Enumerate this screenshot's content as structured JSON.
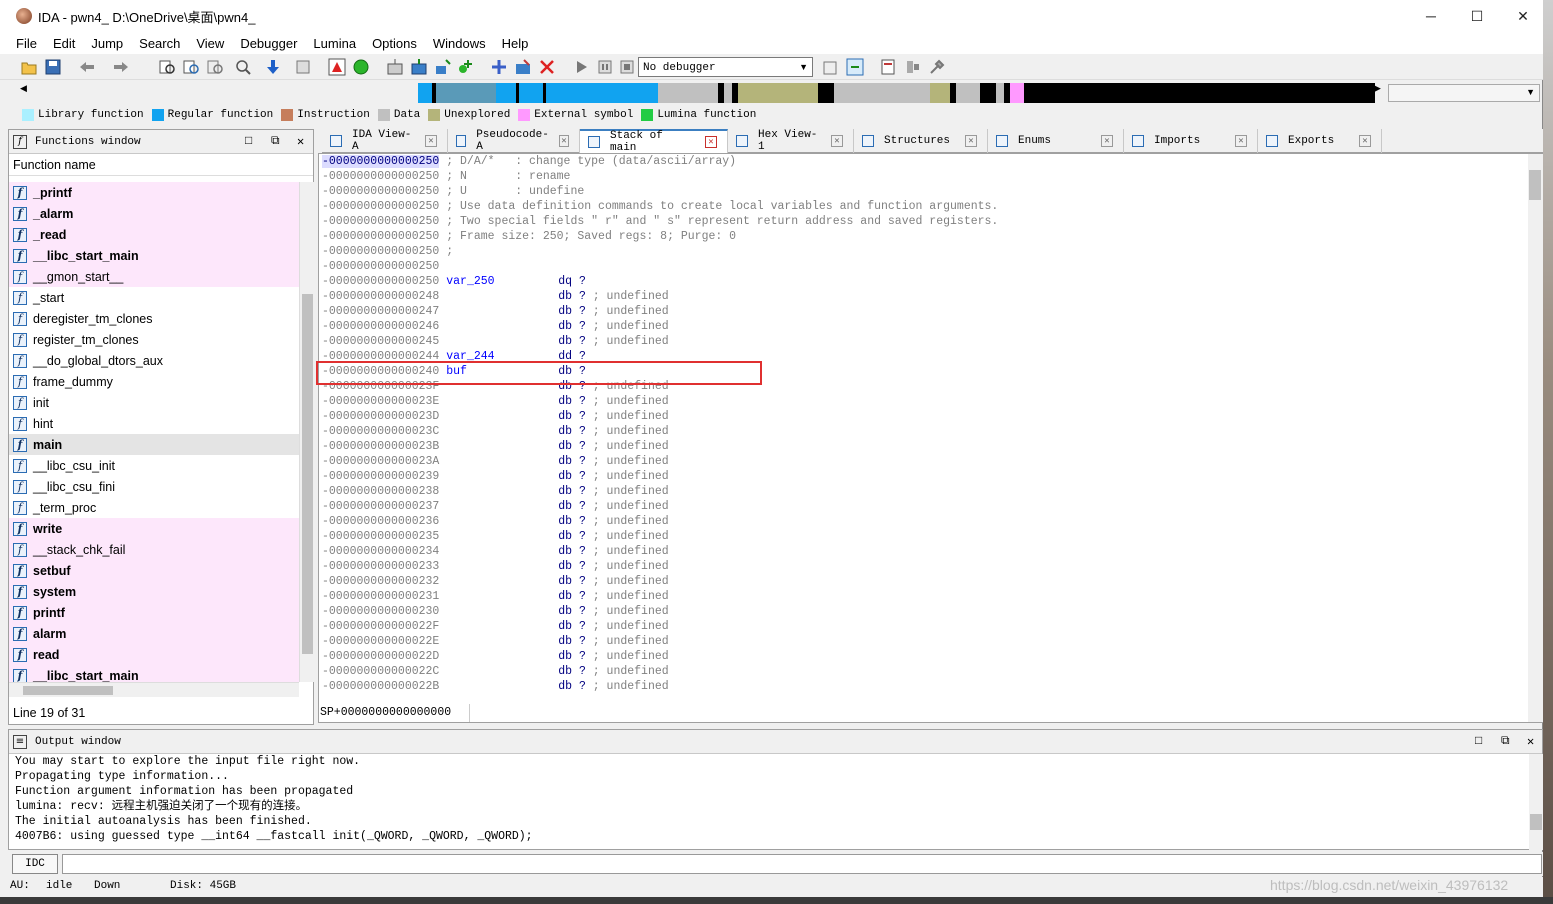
{
  "window": {
    "title": "IDA - pwn4_ D:\\OneDrive\\桌面\\pwn4_",
    "minimize": "─",
    "maximize": "☐",
    "close": "✕"
  },
  "menu": [
    "File",
    "Edit",
    "Jump",
    "Search",
    "View",
    "Debugger",
    "Lumina",
    "Options",
    "Windows",
    "Help"
  ],
  "toolbar": {
    "debugger_select": "No debugger"
  },
  "legend": [
    {
      "label": "Library function",
      "color": "#aaf0ff"
    },
    {
      "label": "Regular function",
      "color": "#11a3f0"
    },
    {
      "label": "Instruction",
      "color": "#c67e5c"
    },
    {
      "label": "Data",
      "color": "#c0c0c0"
    },
    {
      "label": "Unexplored",
      "color": "#b4b47a"
    },
    {
      "label": "External symbol",
      "color": "#ff99ff"
    },
    {
      "label": "Lumina function",
      "color": "#22cc44"
    }
  ],
  "functions_window": {
    "title": "Functions window",
    "column_header": "Function name",
    "status": "Line 19 of 31",
    "items": [
      {
        "name": "_printf",
        "style": "lib bold"
      },
      {
        "name": "_alarm",
        "style": "lib bold"
      },
      {
        "name": "_read",
        "style": "lib bold"
      },
      {
        "name": "__libc_start_main",
        "style": "lib bold"
      },
      {
        "name": "__gmon_start__",
        "style": "lib"
      },
      {
        "name": "_start",
        "style": ""
      },
      {
        "name": "deregister_tm_clones",
        "style": ""
      },
      {
        "name": "register_tm_clones",
        "style": ""
      },
      {
        "name": "__do_global_dtors_aux",
        "style": ""
      },
      {
        "name": "frame_dummy",
        "style": ""
      },
      {
        "name": "init",
        "style": ""
      },
      {
        "name": "hint",
        "style": ""
      },
      {
        "name": "main",
        "style": "sel bold"
      },
      {
        "name": "__libc_csu_init",
        "style": ""
      },
      {
        "name": "__libc_csu_fini",
        "style": ""
      },
      {
        "name": "_term_proc",
        "style": ""
      },
      {
        "name": "write",
        "style": "lib bold"
      },
      {
        "name": "__stack_chk_fail",
        "style": "lib"
      },
      {
        "name": "setbuf",
        "style": "lib bold"
      },
      {
        "name": "system",
        "style": "lib bold"
      },
      {
        "name": "printf",
        "style": "lib bold"
      },
      {
        "name": "alarm",
        "style": "lib bold"
      },
      {
        "name": "read",
        "style": "lib bold"
      },
      {
        "name": "__libc_start_main",
        "style": "lib bold"
      }
    ]
  },
  "tabs": [
    {
      "label": "IDA View-A",
      "active": false
    },
    {
      "label": "Pseudocode-A",
      "active": false
    },
    {
      "label": "Stack of main",
      "active": true
    },
    {
      "label": "Hex View-1",
      "active": false
    },
    {
      "label": "Structures",
      "active": false
    },
    {
      "label": "Enums",
      "active": false
    },
    {
      "label": "Imports",
      "active": false
    },
    {
      "label": "Exports",
      "active": false
    }
  ],
  "stack_view": {
    "header_lines": [
      {
        "addr": "-0000000000000250",
        "rest": " ; D/A/*   : change type (data/ascii/array)"
      },
      {
        "addr": "-0000000000000250",
        "rest": " ; N       : rename"
      },
      {
        "addr": "-0000000000000250",
        "rest": " ; U       : undefine"
      },
      {
        "addr": "-0000000000000250",
        "rest": " ; Use data definition commands to create local variables and function arguments."
      },
      {
        "addr": "-0000000000000250",
        "rest": " ; Two special fields \" r\" and \" s\" represent return address and saved registers."
      },
      {
        "addr": "-0000000000000250",
        "rest": " ; Frame size: 250; Saved regs: 8; Purge: 0"
      },
      {
        "addr": "-0000000000000250",
        "rest": " ;"
      },
      {
        "addr": "-0000000000000250",
        "rest": ""
      }
    ],
    "var_lines": [
      {
        "addr": "-0000000000000250",
        "name": "var_250",
        "type": "dq ?",
        "cmt": ""
      },
      {
        "addr": "-0000000000000248",
        "name": "",
        "type": "db ?",
        "cmt": " ; undefined"
      },
      {
        "addr": "-0000000000000247",
        "name": "",
        "type": "db ?",
        "cmt": " ; undefined"
      },
      {
        "addr": "-0000000000000246",
        "name": "",
        "type": "db ?",
        "cmt": " ; undefined"
      },
      {
        "addr": "-0000000000000245",
        "name": "",
        "type": "db ?",
        "cmt": " ; undefined"
      },
      {
        "addr": "-0000000000000244",
        "name": "var_244",
        "type": "dd ?",
        "cmt": ""
      },
      {
        "addr": "-0000000000000240",
        "name": "buf",
        "type": "db ?",
        "cmt": ""
      },
      {
        "addr": "-000000000000023F",
        "name": "",
        "type": "db ?",
        "cmt": " ; undefined"
      },
      {
        "addr": "-000000000000023E",
        "name": "",
        "type": "db ?",
        "cmt": " ; undefined"
      },
      {
        "addr": "-000000000000023D",
        "name": "",
        "type": "db ?",
        "cmt": " ; undefined"
      },
      {
        "addr": "-000000000000023C",
        "name": "",
        "type": "db ?",
        "cmt": " ; undefined"
      },
      {
        "addr": "-000000000000023B",
        "name": "",
        "type": "db ?",
        "cmt": " ; undefined"
      },
      {
        "addr": "-000000000000023A",
        "name": "",
        "type": "db ?",
        "cmt": " ; undefined"
      },
      {
        "addr": "-0000000000000239",
        "name": "",
        "type": "db ?",
        "cmt": " ; undefined"
      },
      {
        "addr": "-0000000000000238",
        "name": "",
        "type": "db ?",
        "cmt": " ; undefined"
      },
      {
        "addr": "-0000000000000237",
        "name": "",
        "type": "db ?",
        "cmt": " ; undefined"
      },
      {
        "addr": "-0000000000000236",
        "name": "",
        "type": "db ?",
        "cmt": " ; undefined"
      },
      {
        "addr": "-0000000000000235",
        "name": "",
        "type": "db ?",
        "cmt": " ; undefined"
      },
      {
        "addr": "-0000000000000234",
        "name": "",
        "type": "db ?",
        "cmt": " ; undefined"
      },
      {
        "addr": "-0000000000000233",
        "name": "",
        "type": "db ?",
        "cmt": " ; undefined"
      },
      {
        "addr": "-0000000000000232",
        "name": "",
        "type": "db ?",
        "cmt": " ; undefined"
      },
      {
        "addr": "-0000000000000231",
        "name": "",
        "type": "db ?",
        "cmt": " ; undefined"
      },
      {
        "addr": "-0000000000000230",
        "name": "",
        "type": "db ?",
        "cmt": " ; undefined"
      },
      {
        "addr": "-000000000000022F",
        "name": "",
        "type": "db ?",
        "cmt": " ; undefined"
      },
      {
        "addr": "-000000000000022E",
        "name": "",
        "type": "db ?",
        "cmt": " ; undefined"
      },
      {
        "addr": "-000000000000022D",
        "name": "",
        "type": "db ?",
        "cmt": " ; undefined"
      },
      {
        "addr": "-000000000000022C",
        "name": "",
        "type": "db ?",
        "cmt": " ; undefined"
      },
      {
        "addr": "-000000000000022B",
        "name": "",
        "type": "db ?",
        "cmt": " ; undefined"
      }
    ],
    "status": "SP+0000000000000000"
  },
  "output_window": {
    "title": "Output window",
    "lines": [
      "You may start to explore the input file right now.",
      "Propagating type information...",
      "Function argument information has been propagated",
      "lumina: recv: 远程主机强迫关闭了一个现有的连接。",
      "The initial autoanalysis has been finished.",
      "4007B6: using guessed type __int64 __fastcall init(_QWORD, _QWORD, _QWORD);"
    ]
  },
  "command_line": {
    "language": "IDC"
  },
  "statusbar": {
    "au": "AU:",
    "state": "idle",
    "direction": "Down",
    "disk": "Disk: 45GB"
  },
  "watermark": "https://blog.csdn.net/weixin_43976132"
}
